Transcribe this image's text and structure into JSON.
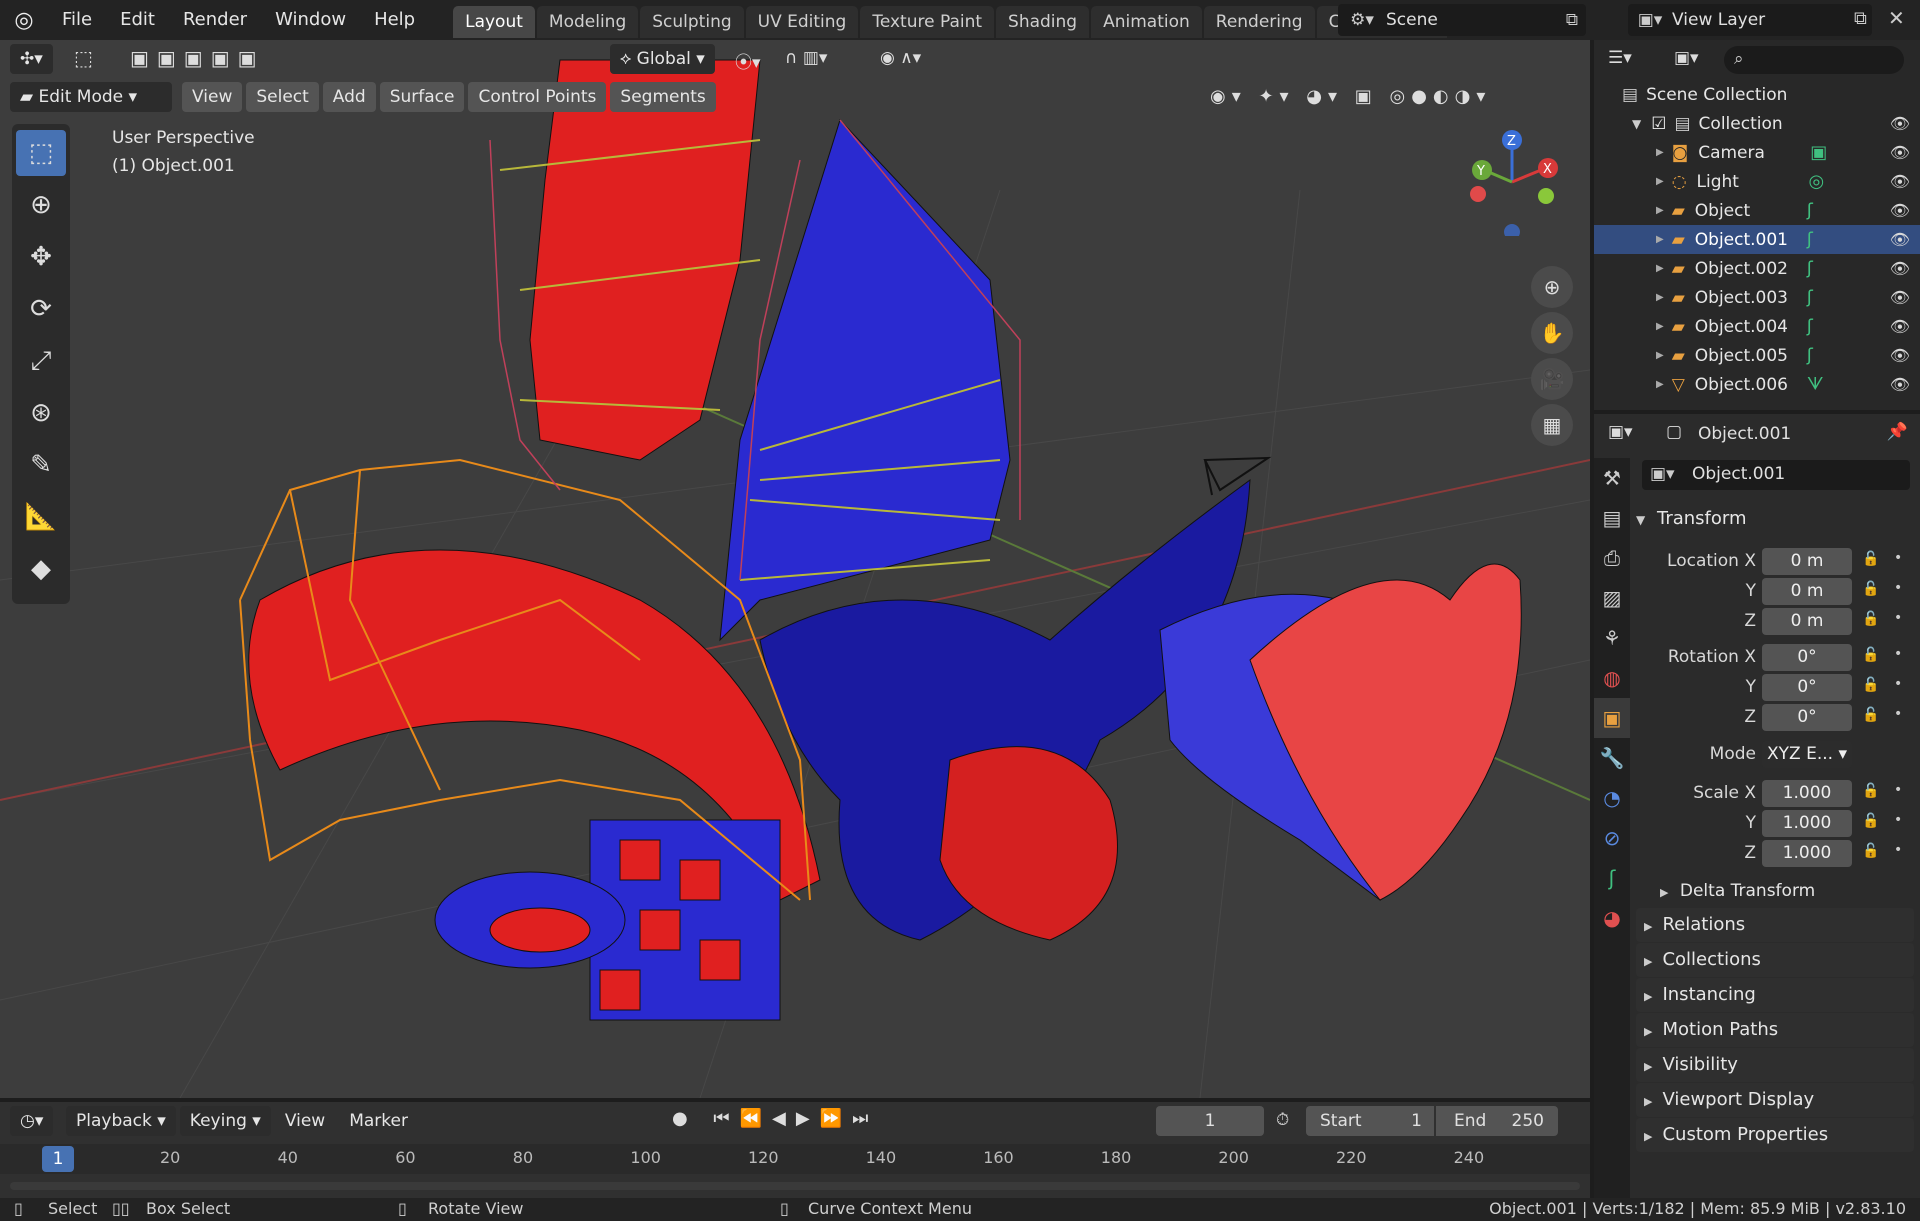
{
  "topbar": {
    "menus": [
      "File",
      "Edit",
      "Render",
      "Window",
      "Help"
    ],
    "workspaces": [
      "Layout",
      "Modeling",
      "Sculpting",
      "UV Editing",
      "Texture Paint",
      "Shading",
      "Animation",
      "Rendering",
      "Compositing"
    ],
    "active_workspace": "Layout",
    "scene": "Scene",
    "view_layer": "View Layer"
  },
  "viewport": {
    "transform_orientation": "Global",
    "mode": "Edit Mode",
    "menus": [
      "View",
      "Select",
      "Add",
      "Surface",
      "Control Points",
      "Segments"
    ],
    "overlay_line1": "User Perspective",
    "overlay_line2": "(1) Object.001",
    "gizmo": {
      "x": "X",
      "y": "Y",
      "z": "Z"
    }
  },
  "outliner": {
    "root": "Scene Collection",
    "collection": "Collection",
    "items": [
      {
        "name": "Camera",
        "icon": "camera-icon"
      },
      {
        "name": "Light",
        "icon": "light-icon"
      },
      {
        "name": "Object",
        "icon": "curve-icon"
      },
      {
        "name": "Object.001",
        "icon": "curve-icon",
        "selected": true
      },
      {
        "name": "Object.002",
        "icon": "curve-icon"
      },
      {
        "name": "Object.003",
        "icon": "curve-icon"
      },
      {
        "name": "Object.004",
        "icon": "curve-icon"
      },
      {
        "name": "Object.005",
        "icon": "curve-icon"
      },
      {
        "name": "Object.006",
        "icon": "mesh-icon"
      }
    ]
  },
  "properties": {
    "context_object": "Object.001",
    "object_name": "Object.001",
    "transform_title": "Transform",
    "location_label": "Location X",
    "rotation_label": "Rotation X",
    "scale_label": "Scale X",
    "y_label": "Y",
    "z_label": "Z",
    "location": [
      "0 m",
      "0 m",
      "0 m"
    ],
    "rotation": [
      "0°",
      "0°",
      "0°"
    ],
    "mode_label": "Mode",
    "mode_value": "XYZ E...",
    "scale": [
      "1.000",
      "1.000",
      "1.000"
    ],
    "delta": "Delta Transform",
    "panels": [
      "Relations",
      "Collections",
      "Instancing",
      "Motion Paths",
      "Visibility",
      "Viewport Display",
      "Custom Properties"
    ]
  },
  "timeline": {
    "menus": [
      "Playback",
      "Keying",
      "View",
      "Marker"
    ],
    "current_frame": "1",
    "start_label": "Start",
    "start": "1",
    "end_label": "End",
    "end": "250",
    "ruler_current": "1",
    "ruler": [
      "20",
      "40",
      "60",
      "80",
      "100",
      "120",
      "140",
      "160",
      "180",
      "200",
      "220",
      "240"
    ]
  },
  "statusbar": {
    "select": "Select",
    "box_select": "Box Select",
    "rotate": "Rotate View",
    "context": "Curve Context Menu",
    "info": "Object.001 | Verts:1/182 | Mem: 85.9 MiB | v2.83.10"
  },
  "colors": {
    "accent": "#4772b3",
    "selected_row": "#334d80",
    "red_surface": "#e02020",
    "blue_surface": "#2a2ad0",
    "orange_cage": "#e88a1a"
  }
}
